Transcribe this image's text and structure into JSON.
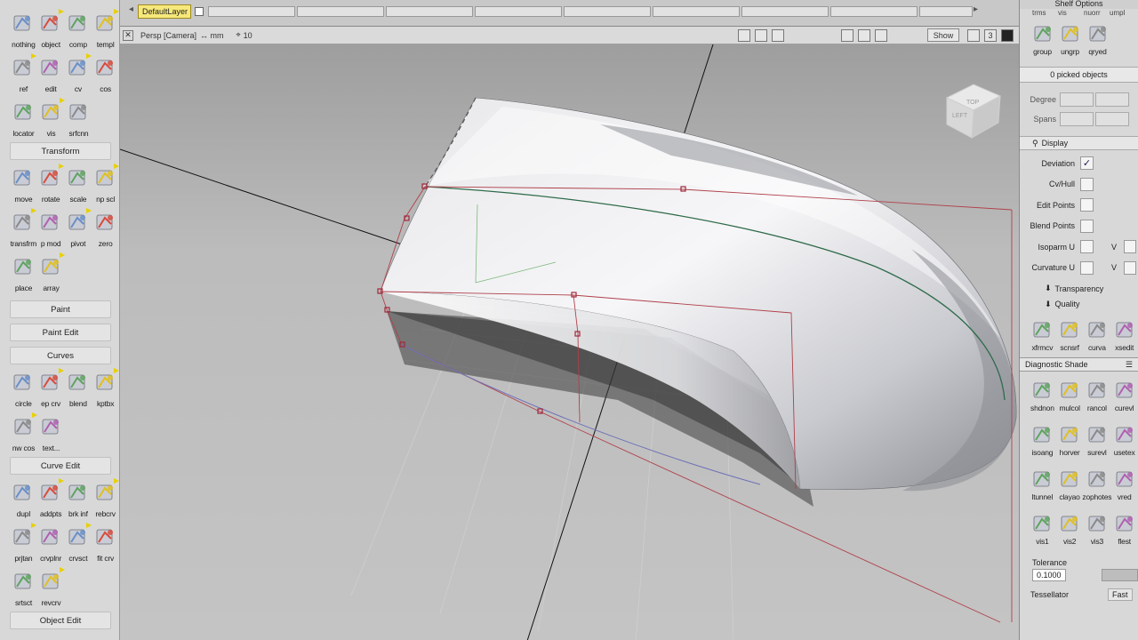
{
  "palette": {
    "rows": [
      [
        {
          "label": "nothing",
          "icon": "pick-nothing-icon"
        },
        {
          "label": "object",
          "icon": "pick-object-icon"
        },
        {
          "label": "comp",
          "icon": "pick-component-icon"
        },
        {
          "label": "templ",
          "icon": "pick-template-icon"
        }
      ],
      [
        {
          "label": "ref",
          "icon": "pick-reference-icon"
        },
        {
          "label": "edit",
          "icon": "pick-edit-icon"
        },
        {
          "label": "cv",
          "icon": "pick-cv-icon"
        },
        {
          "label": "cos",
          "icon": "pick-cos-icon"
        }
      ],
      [
        {
          "label": "locator",
          "icon": "pick-locator-icon"
        },
        {
          "label": "vis",
          "icon": "pick-visible-icon"
        },
        {
          "label": "srfcnn",
          "icon": "pick-surface-connect-icon"
        }
      ]
    ],
    "sections": {
      "transform": "Transform",
      "paint": "Paint",
      "paint_edit": "Paint Edit",
      "curves": "Curves",
      "curve_edit": "Curve Edit",
      "object_edit": "Object Edit"
    },
    "transform_rows": [
      [
        {
          "label": "move",
          "icon": "move-icon"
        },
        {
          "label": "rotate",
          "icon": "rotate-icon"
        },
        {
          "label": "scale",
          "icon": "scale-icon"
        },
        {
          "label": "np scl",
          "icon": "nonprop-scale-icon"
        }
      ],
      [
        {
          "label": "transfrm",
          "icon": "transform-icon"
        },
        {
          "label": "p mod",
          "icon": "pivot-modify-icon"
        },
        {
          "label": "pivot",
          "icon": "pivot-icon"
        },
        {
          "label": "zero",
          "icon": "zero-icon"
        }
      ],
      [
        {
          "label": "place",
          "icon": "place-icon"
        },
        {
          "label": "array",
          "icon": "array-icon"
        }
      ]
    ],
    "curves_rows": [
      [
        {
          "label": "circle",
          "icon": "circle-icon"
        },
        {
          "label": "ep crv",
          "icon": "ep-curve-icon"
        },
        {
          "label": "blend",
          "icon": "blend-curve-icon"
        },
        {
          "label": "kptbx",
          "icon": "keypoint-toolbox-icon"
        }
      ],
      [
        {
          "label": "nw cos",
          "icon": "new-cos-icon"
        },
        {
          "label": "text...",
          "icon": "text-icon"
        }
      ]
    ],
    "curve_edit_rows": [
      [
        {
          "label": "dupl",
          "icon": "duplicate-curve-icon"
        },
        {
          "label": "addpts",
          "icon": "add-points-icon"
        },
        {
          "label": "brk inf",
          "icon": "break-inflection-icon"
        },
        {
          "label": "rebcrv",
          "icon": "rebuild-curve-icon"
        }
      ],
      [
        {
          "label": "prjtan",
          "icon": "project-tangent-icon"
        },
        {
          "label": "crvplnr",
          "icon": "curve-planar-icon"
        },
        {
          "label": "crvsct",
          "icon": "curve-section-icon"
        },
        {
          "label": "fit crv",
          "icon": "fit-curve-icon"
        }
      ],
      [
        {
          "label": "srtsct",
          "icon": "sort-section-icon"
        },
        {
          "label": "revcrv",
          "icon": "reverse-curve-icon"
        }
      ]
    ]
  },
  "layers": {
    "default_label": "DefaultLayer"
  },
  "viewport": {
    "camera": "Persp [Camera]",
    "units": "↔ mm",
    "grid_label": "10",
    "show_label": "Show",
    "num_label": "3",
    "viewcube": {
      "top": "TOP",
      "left": "LEFT"
    }
  },
  "right_panel": {
    "shelf_options": "Shelf Options",
    "top_labels": [
      "trms",
      "vis",
      "nuorr",
      "umpl"
    ],
    "group_tools": [
      {
        "label": "group",
        "icon": "group-icon"
      },
      {
        "label": "ungrp",
        "icon": "ungroup-icon"
      },
      {
        "label": "qryed",
        "icon": "query-edit-icon"
      }
    ],
    "picked": "0 picked objects",
    "degree_label": "Degree",
    "spans_label": "Spans",
    "display_header": "Display",
    "display_rows": [
      {
        "label": "Deviation",
        "checked": true
      },
      {
        "label": "Cv/Hull",
        "checked": false
      },
      {
        "label": "Edit Points",
        "checked": false
      },
      {
        "label": "Blend Points",
        "checked": false
      },
      {
        "label": "Isoparm U",
        "checked": false,
        "v": "V"
      },
      {
        "label": "Curvature U",
        "checked": false,
        "v": "V"
      }
    ],
    "transparency": "Transparency",
    "quality": "Quality",
    "shelf_tools": [
      {
        "label": "xfrmcv",
        "icon": "transform-cv-icon"
      },
      {
        "label": "scnsrf",
        "icon": "scan-surface-icon"
      },
      {
        "label": "curva",
        "icon": "curvature-icon"
      },
      {
        "label": "xsedit",
        "icon": "cross-section-edit-icon"
      }
    ],
    "diag_header": "Diagnostic Shade",
    "diag_tools": [
      [
        {
          "label": "shdnon",
          "icon": "shade-none-icon"
        },
        {
          "label": "mulcol",
          "icon": "multi-color-icon"
        },
        {
          "label": "rancol",
          "icon": "random-color-icon"
        },
        {
          "label": "curevl",
          "icon": "curvature-eval-icon"
        }
      ],
      [
        {
          "label": "isoang",
          "icon": "isoangle-icon"
        },
        {
          "label": "horver",
          "icon": "horizon-vertical-icon"
        },
        {
          "label": "surevl",
          "icon": "surface-eval-icon"
        },
        {
          "label": "usetex",
          "icon": "use-texture-icon"
        }
      ],
      [
        {
          "label": "ltunnel",
          "icon": "light-tunnel-icon"
        },
        {
          "label": "clayao",
          "icon": "clay-ao-icon"
        },
        {
          "label": "zophotes",
          "icon": "zebra-icon"
        },
        {
          "label": "vred",
          "icon": "vred-icon"
        }
      ],
      [
        {
          "label": "vis1",
          "icon": "visual-1-icon"
        },
        {
          "label": "vis2",
          "icon": "visual-2-icon"
        },
        {
          "label": "vis3",
          "icon": "visual-3-icon"
        },
        {
          "label": "flest",
          "icon": "flest-icon"
        }
      ]
    ],
    "tolerance_label": "Tolerance",
    "tolerance_value": "0.1000",
    "tessellator_label": "Tessellator",
    "tessellator_value": "Fast"
  }
}
